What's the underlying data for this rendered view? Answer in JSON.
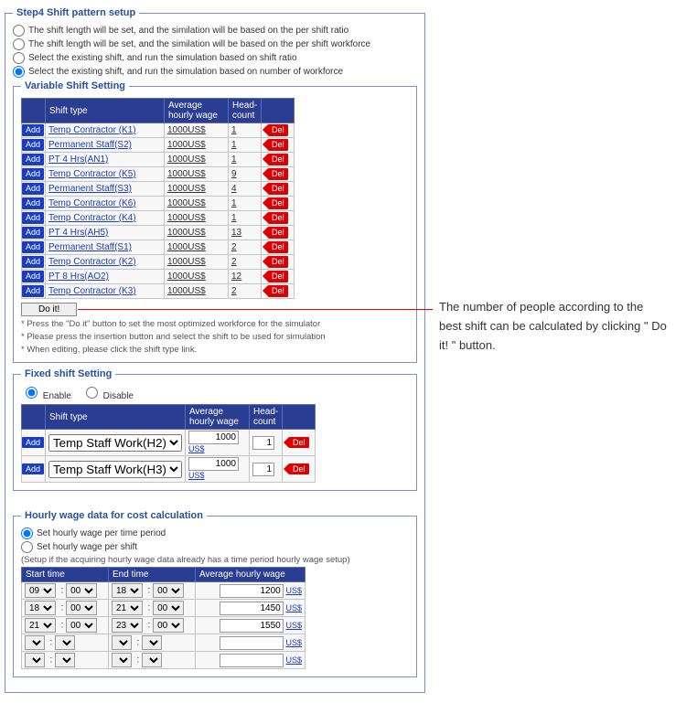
{
  "step": {
    "legend": "Step4  Shift pattern setup",
    "options": [
      {
        "label": "The shift length will be set, and the similation will be based on the per shift ratio"
      },
      {
        "label": "The shift length will be set, and the similation will be based on the per shift workforce"
      },
      {
        "label": "Select the existing shift, and run the simulation based on shift ratio"
      },
      {
        "label": "Select the existing shift, and run the simulation based on number of workforce"
      }
    ]
  },
  "variable": {
    "legend": "Variable Shift Setting",
    "headers": {
      "shift": "Shift type",
      "wage": "Average hourly wage",
      "hc": "Head-count"
    },
    "addLabel": "Add",
    "delLabel": "Del",
    "rows": [
      {
        "shift": "Temp Contractor (K1)",
        "wage": "1000US$",
        "hc": "1"
      },
      {
        "shift": "Permanent Staff(S2)",
        "wage": "1000US$",
        "hc": "1"
      },
      {
        "shift": "PT 4 Hrs(AN1)",
        "wage": "1000US$",
        "hc": "1"
      },
      {
        "shift": "Temp Contractor (K5)",
        "wage": "1000US$",
        "hc": "9"
      },
      {
        "shift": "Permanent Staff(S3)",
        "wage": "1000US$",
        "hc": "4"
      },
      {
        "shift": "Temp Contractor (K6)",
        "wage": "1000US$",
        "hc": "1"
      },
      {
        "shift": "Temp Contractor (K4)",
        "wage": "1000US$",
        "hc": "1"
      },
      {
        "shift": "PT 4 Hrs(AH5)",
        "wage": "1000US$",
        "hc": "13"
      },
      {
        "shift": "Permanent Staff(S1)",
        "wage": "1000US$",
        "hc": "2"
      },
      {
        "shift": "Temp Contractor (K2)",
        "wage": "1000US$",
        "hc": "2"
      },
      {
        "shift": "PT 8 Hrs(AO2)",
        "wage": "1000US$",
        "hc": "12"
      },
      {
        "shift": "Temp Contractor (K3)",
        "wage": "1000US$",
        "hc": "2"
      }
    ],
    "doit": "Do it!",
    "note1": "* Press the \"Do it\" button to set the most optimized workforce for the simulator",
    "note2": "* Please press the insertion button and select the shift to be used for simulation",
    "note3": "* When editing, please click the shift type link."
  },
  "fixed": {
    "legend": "Fixed shift Setting",
    "enable": "Enable",
    "disable": "Disable",
    "headers": {
      "shift": "Shift type",
      "wage": "Average hourly wage",
      "hc": "Head-count"
    },
    "addLabel": "Add",
    "delLabel": "Del",
    "us": "US$",
    "rows": [
      {
        "shift": "Temp Staff Work(H2)",
        "wage": "1000",
        "hc": "1"
      },
      {
        "shift": "Temp Staff Work(H3)",
        "wage": "1000",
        "hc": "1"
      }
    ]
  },
  "hourly": {
    "legend": "Hourly wage data for cost calculation",
    "opt1": "Set hourly wage per time period",
    "opt2": "Set hourly wage per shift",
    "note": "(Setup if the acquiring hourly wage data already has a time period hourly wage setup)",
    "headers": {
      "start": "Start time",
      "end": "End time",
      "wage": "Average hourly wage"
    },
    "us": "US$",
    "rows": [
      {
        "sh": "09",
        "sm": "00",
        "eh": "18",
        "em": "00",
        "wage": "1200"
      },
      {
        "sh": "18",
        "sm": "00",
        "eh": "21",
        "em": "00",
        "wage": "1450"
      },
      {
        "sh": "21",
        "sm": "00",
        "eh": "23",
        "em": "00",
        "wage": "1550"
      },
      {
        "sh": "",
        "sm": "",
        "eh": "",
        "em": "",
        "wage": ""
      },
      {
        "sh": "",
        "sm": "",
        "eh": "",
        "em": "",
        "wage": ""
      }
    ]
  },
  "annotation": {
    "text": "The number of people according to the best shift can be calculated by clicking \" Do it! \" button."
  }
}
